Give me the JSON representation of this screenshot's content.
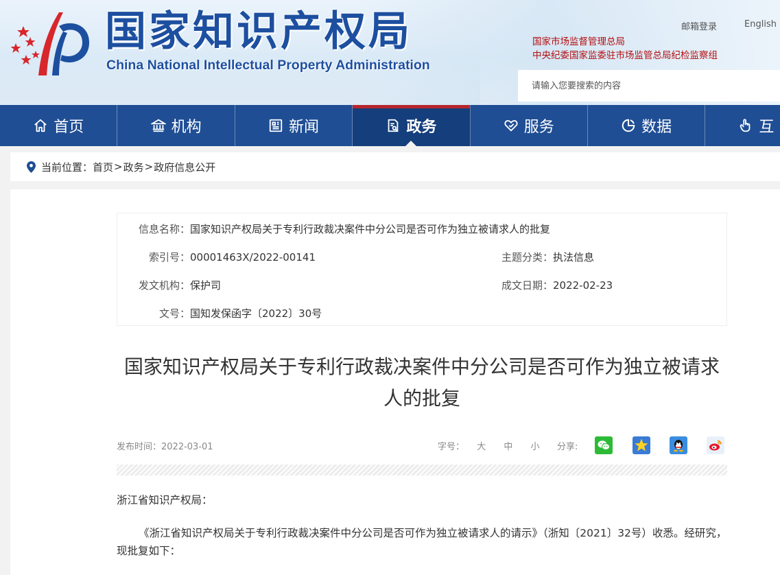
{
  "header": {
    "brand_cn": "国家知识产权局",
    "brand_en": "China National Intellectual Property Administration",
    "top_links": {
      "mail_login": "邮箱登录",
      "english": "English"
    },
    "org_links": [
      "国家市场监督管理总局",
      "中央纪委国家监委驻市场监管总局纪检监察组"
    ],
    "search": {
      "placeholder": "请输入您要搜索的内容"
    }
  },
  "nav": {
    "items": [
      {
        "label": "首页",
        "icon": "home-icon"
      },
      {
        "label": "机构",
        "icon": "institution-icon"
      },
      {
        "label": "新闻",
        "icon": "newspaper-icon"
      },
      {
        "label": "政务",
        "icon": "government-doc-icon",
        "active": true
      },
      {
        "label": "服务",
        "icon": "service-heart-icon"
      },
      {
        "label": "数据",
        "icon": "pie-chart-icon"
      },
      {
        "label": "互",
        "icon": "hand-pointer-icon"
      }
    ],
    "colors": {
      "bar": "#1f4e94",
      "active": "#143e7c",
      "active_top": "#b7262d"
    }
  },
  "breadcrumb": {
    "prefix": "当前位置：",
    "items": [
      "首页",
      "政务",
      "政府信息公开"
    ],
    "separator": ">"
  },
  "info": {
    "name_label": "信息名称：",
    "name_value": "国家知识产权局关于专利行政裁决案件中分公司是否可作为独立被请求人的批复",
    "index_label": "索引号：",
    "index_value": "00001463X/2022-00141",
    "category_label": "主题分类：",
    "category_value": "执法信息",
    "issuer_label": "发文机构：",
    "issuer_value": "保护司",
    "date_label": "成文日期：",
    "date_value": "2022-02-23",
    "docno_label": "文号：",
    "docno_value": "国知发保函字〔2022〕30号"
  },
  "article": {
    "title_line1": "国家知识产权局关于专利行政裁决案件中分公司是否可作为独立被请求",
    "title_line2": "人的批复",
    "pub_label": "发布时间：",
    "pub_date": "2022-03-01",
    "font_size_label": "字号：",
    "font_sizes": [
      "大",
      "中",
      "小"
    ],
    "share_label": "分享:",
    "salutation": "浙江省知识产权局：",
    "paragraph1": "《浙江省知识产权局关于专利行政裁决案件中分公司是否可作为独立被请求人的请示》（浙知〔2021〕32号）收悉。经研究，现批复如下："
  }
}
